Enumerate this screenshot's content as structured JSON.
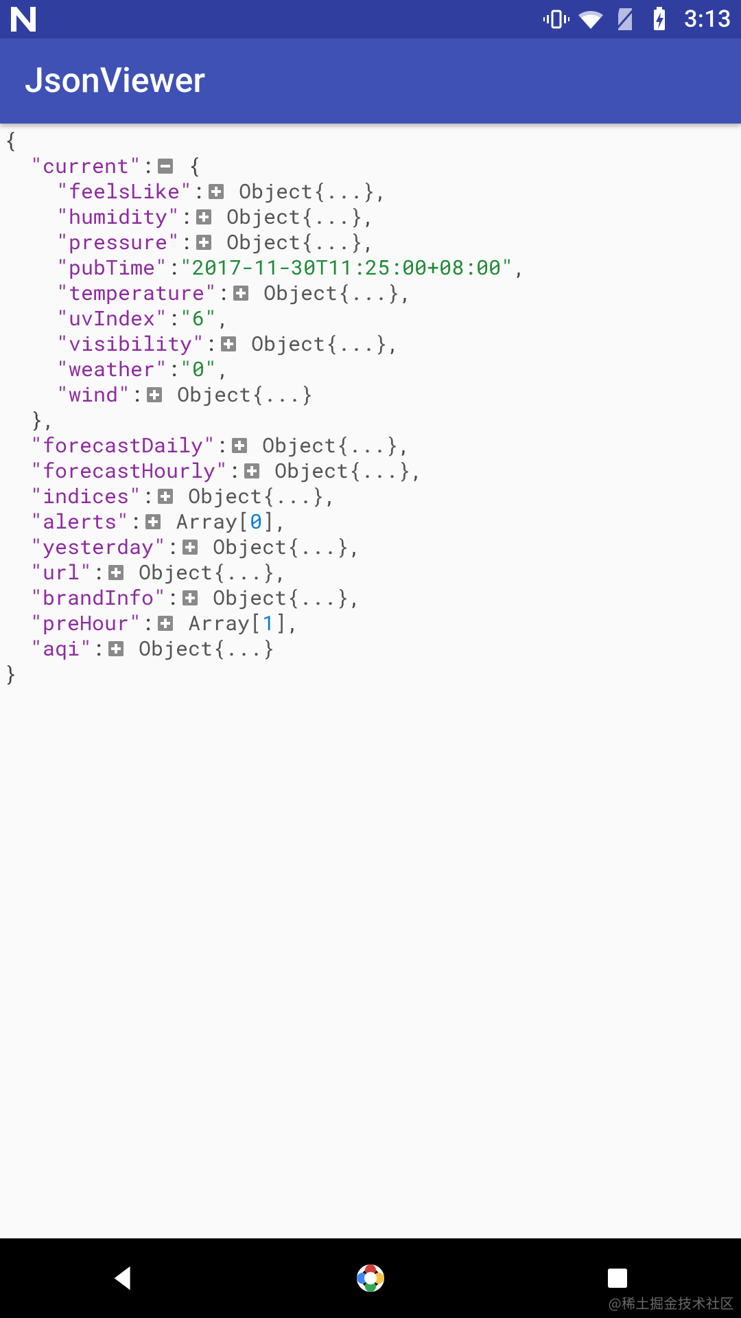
{
  "statusbar": {
    "time": "3:13"
  },
  "appbar": {
    "title": "JsonViewer"
  },
  "placeholders": {
    "objectCollapsed": "Object{...}",
    "arrayLabel": "Array"
  },
  "json": {
    "open": "{",
    "close": "}",
    "rows": [
      {
        "key": "current",
        "expanded": true,
        "open": "{",
        "children": [
          {
            "key": "feelsLike",
            "type": "object"
          },
          {
            "key": "humidity",
            "type": "object"
          },
          {
            "key": "pressure",
            "type": "object"
          },
          {
            "key": "pubTime",
            "type": "string",
            "value": "2017-11-30T11:25:00+08:00"
          },
          {
            "key": "temperature",
            "type": "object"
          },
          {
            "key": "uvIndex",
            "type": "string",
            "value": "6"
          },
          {
            "key": "visibility",
            "type": "object"
          },
          {
            "key": "weather",
            "type": "string",
            "value": "0"
          },
          {
            "key": "wind",
            "type": "object",
            "last": true
          }
        ],
        "close": "}"
      },
      {
        "key": "forecastDaily",
        "type": "object"
      },
      {
        "key": "forecastHourly",
        "type": "object"
      },
      {
        "key": "indices",
        "type": "object"
      },
      {
        "key": "alerts",
        "type": "array",
        "count": 0
      },
      {
        "key": "yesterday",
        "type": "object"
      },
      {
        "key": "url",
        "type": "object"
      },
      {
        "key": "brandInfo",
        "type": "object"
      },
      {
        "key": "preHour",
        "type": "array",
        "count": 1
      },
      {
        "key": "aqi",
        "type": "object",
        "last": true
      }
    ]
  },
  "watermark": "@稀土掘金技术社区"
}
